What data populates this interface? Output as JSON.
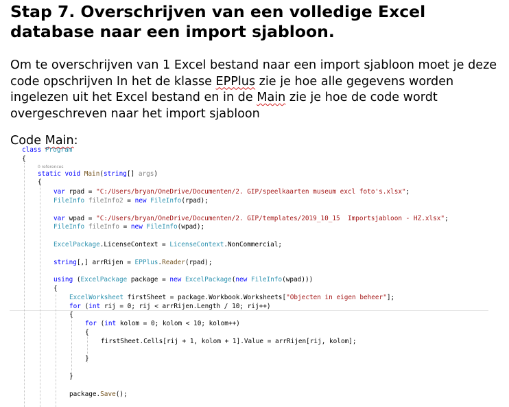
{
  "heading": {
    "line1": "Stap 7. Overschrijven van een volledige Excel",
    "line2": "database naar een import sjabloon."
  },
  "paragraph": {
    "part1": "Om te overschrijven van 1 Excel bestand naar een import sjabloon moet je deze code opschrijven In het de klasse ",
    "epplus": "EPPlus",
    "part2": " zie je hoe alle gegevens worden ingelezen uit het Excel bestand en in de ",
    "main": "Main",
    "part3": " zie je hoe de code wordt overgeschreven naar het import sjabloon"
  },
  "code_label": {
    "prefix": "Code ",
    "main": "Main",
    "suffix": ":"
  },
  "code": {
    "l1_kw": "class",
    "l1_type": "Program",
    "l2": "{",
    "l3_refs": "0 references",
    "l4_static": "static",
    "l4_void": "void",
    "l4_name": "Main",
    "l4_open": "(",
    "l4_string": "string",
    "l4_bracket": "[] ",
    "l4_args": "args",
    "l4_close": ")",
    "l5": "{",
    "l6_var": "var",
    "l6_name": " rpad = ",
    "l6_str": "\"C:/Users/bryan/OneDrive/Documenten/2. GIP/speelkaarten museum excl foto's.xlsx\"",
    "l6_end": ";",
    "l7_type": "FileInfo",
    "l7_var": "fileInfo2",
    "l7_eq": " = ",
    "l7_new": "new",
    "l7_type2": "FileInfo",
    "l7_end": "(rpad);",
    "l8_var": "var",
    "l8_name": " wpad = ",
    "l8_str": "\"C:/Users/bryan/OneDrive/Documenten/2. GIP/templates/2019_10_15  Importsjabloon - HZ.xlsx\"",
    "l8_end": ";",
    "l9_type": "FileInfo",
    "l9_var": "fileInfo",
    "l9_eq": " = ",
    "l9_new": "new",
    "l9_type2": "FileInfo",
    "l9_end": "(wpad);",
    "l10_type": "ExcelPackage",
    "l10_mid": ".LicenseContext = ",
    "l10_type2": "LicenseContext",
    "l10_end": ".NonCommercial;",
    "l11_kw": "string",
    "l11_mid": "[,] arrRijen = ",
    "l11_type": "EPPlus",
    "l11_dot": ".",
    "l11_method": "Reader",
    "l11_end": "(rpad);",
    "l12_using": "using",
    "l12_open": " (",
    "l12_type": "ExcelPackage",
    "l12_mid": " package = ",
    "l12_new": "new",
    "l12_type2": "ExcelPackage",
    "l12_open2": "(",
    "l12_new2": "new",
    "l12_type3": "FileInfo",
    "l12_end": "(wpad)))",
    "l13": "{",
    "l14_type": "ExcelWorksheet",
    "l14_mid": " firstSheet = package.Workbook.Worksheets[",
    "l14_str": "\"Objecten in eigen beheer\"",
    "l14_end": "];",
    "l15_for": "for",
    "l15_open": " (",
    "l15_int": "int",
    "l15_rest": " rij = 0; rij < arrRijen.Length / 10; rij++)",
    "l16": "{",
    "l17_for": "for",
    "l17_open": " (",
    "l17_int": "int",
    "l17_rest": " kolom = 0; kolom < 10; kolom++)",
    "l18": "{",
    "l19": "firstSheet.Cells[rij + 1, kolom + 1].Value = arrRijen[rij, kolom];",
    "l20": "}",
    "l21": "}",
    "l22_pre": "package.",
    "l22_method": "Save",
    "l22_end": "();"
  }
}
